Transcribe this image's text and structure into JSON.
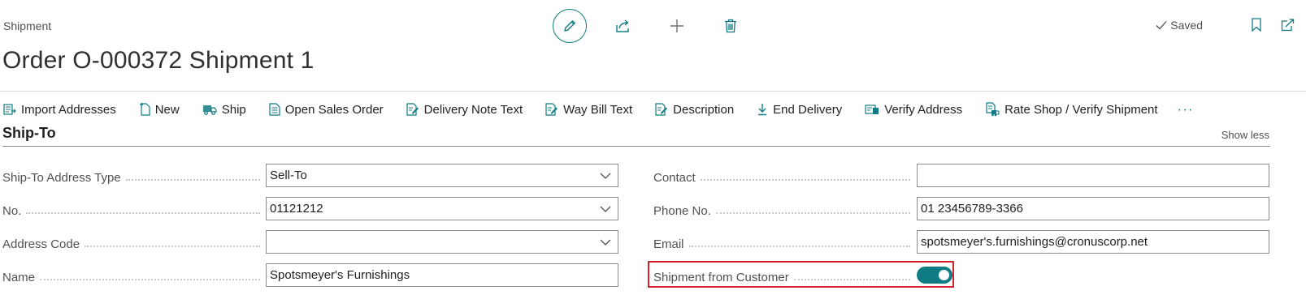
{
  "header": {
    "caption": "Shipment",
    "title": "Order O-000372 Shipment 1",
    "saved_label": "Saved"
  },
  "top_actions": [
    {
      "name": "edit-icon"
    },
    {
      "name": "share-icon"
    },
    {
      "name": "plus-icon"
    },
    {
      "name": "delete-icon"
    }
  ],
  "action_bar": {
    "items": [
      {
        "label": "Import Addresses",
        "icon": "import-addresses-icon"
      },
      {
        "label": "New",
        "icon": "new-document-icon"
      },
      {
        "label": "Ship",
        "icon": "truck-icon"
      },
      {
        "label": "Open Sales Order",
        "icon": "document-icon"
      },
      {
        "label": "Delivery Note Text",
        "icon": "edit-document-icon"
      },
      {
        "label": "Way Bill Text",
        "icon": "edit-document-icon"
      },
      {
        "label": "Description",
        "icon": "edit-document-icon"
      },
      {
        "label": "End Delivery",
        "icon": "download-icon"
      },
      {
        "label": "Verify Address",
        "icon": "verify-address-icon"
      },
      {
        "label": "Rate Shop / Verify Shipment",
        "icon": "rate-shop-icon"
      }
    ],
    "more": "···"
  },
  "section": {
    "title": "Ship-To",
    "show_less": "Show less"
  },
  "fields_left": [
    {
      "label": "Ship-To Address Type",
      "value": "Sell-To",
      "dropdown": true
    },
    {
      "label": "No.",
      "value": "01121212",
      "dropdown": true
    },
    {
      "label": "Address Code",
      "value": "",
      "dropdown": true
    },
    {
      "label": "Name",
      "value": "Spotsmeyer's Furnishings",
      "dropdown": false
    }
  ],
  "fields_right": [
    {
      "label": "Contact",
      "value": ""
    },
    {
      "label": "Phone No.",
      "value": "01 23456789-3366"
    },
    {
      "label": "Email",
      "value": "spotsmeyer's.furnishings@cronuscorp.net"
    },
    {
      "label": "Shipment from Customer",
      "toggle_on": true
    }
  ],
  "colors": {
    "accent": "#0f7b83",
    "highlight": "#d0212c"
  }
}
